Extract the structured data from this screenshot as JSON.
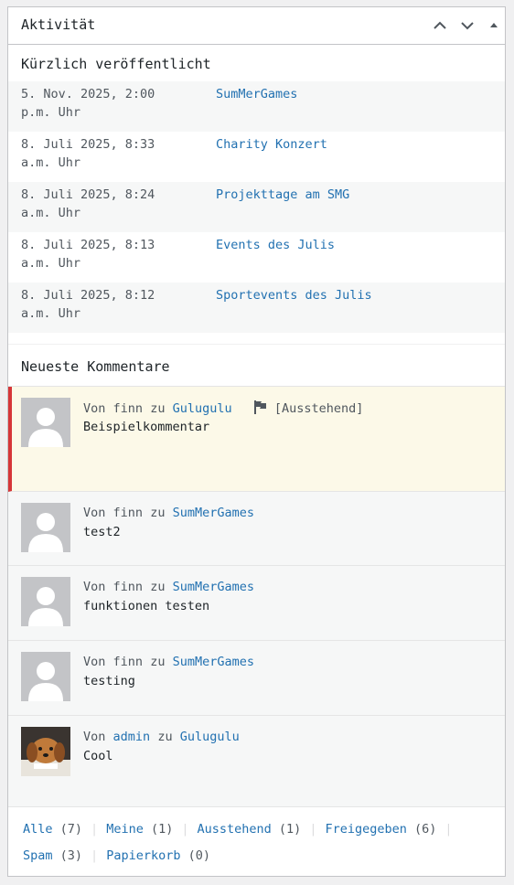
{
  "widget": {
    "title": "Aktivität"
  },
  "published": {
    "title": "Kürzlich veröffentlicht",
    "items": [
      {
        "date_line1": "5. Nov. 2025, 2:00",
        "date_line2": "p.m. Uhr",
        "title": "SumMerGames"
      },
      {
        "date_line1": "8. Juli 2025, 8:33",
        "date_line2": "a.m. Uhr",
        "title": "Charity Konzert"
      },
      {
        "date_line1": "8. Juli 2025, 8:24",
        "date_line2": "a.m. Uhr",
        "title": "Projekttage am SMG"
      },
      {
        "date_line1": "8. Juli 2025, 8:13",
        "date_line2": "a.m. Uhr",
        "title": "Events des Julis"
      },
      {
        "date_line1": "8. Juli 2025, 8:12",
        "date_line2": "a.m. Uhr",
        "title": "Sportevents des Julis"
      }
    ]
  },
  "comments": {
    "title": "Neueste Kommentare",
    "von": "Von",
    "zu": "zu",
    "items": [
      {
        "author": "finn",
        "post": "Gulugulu",
        "text": "Beispielkommentar",
        "status": "[Ausstehend]"
      },
      {
        "author": "finn",
        "post": "SumMerGames",
        "text": "test2"
      },
      {
        "author": "finn",
        "post": "SumMerGames",
        "text": "funktionen testen"
      },
      {
        "author": "finn",
        "post": "SumMerGames",
        "text": "testing"
      },
      {
        "author": "admin",
        "post": "Gulugulu",
        "text": "Cool"
      }
    ]
  },
  "footer": {
    "links": [
      {
        "label": "Alle",
        "count": "(7)"
      },
      {
        "label": "Meine",
        "count": "(1)"
      },
      {
        "label": "Ausstehend",
        "count": "(1)"
      },
      {
        "label": "Freigegeben",
        "count": "(6)"
      },
      {
        "label": "Spam",
        "count": "(3)"
      },
      {
        "label": "Papierkorb",
        "count": "(0)"
      }
    ],
    "separator": "|"
  },
  "colors": {
    "link": "#2271b1",
    "pending_border": "#d63638",
    "pending_bg": "#fcf9e8"
  }
}
